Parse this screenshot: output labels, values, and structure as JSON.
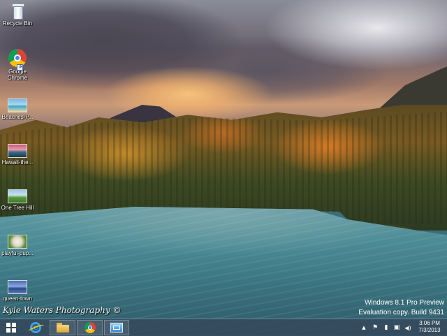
{
  "desktop": {
    "icons": [
      {
        "label": "Recycle Bin"
      },
      {
        "label": "Google Chrome"
      },
      {
        "label": "Beaches-P..."
      },
      {
        "label": "Hawaii-the..."
      },
      {
        "label": "One Tree Hill"
      },
      {
        "label": "playful-pup..."
      },
      {
        "label": "queen-town"
      }
    ],
    "watermark": "Kyle Waters Photography ©",
    "edition_line1": "Windows 8.1 Pro Preview",
    "edition_line2": "Evaluation copy. Build 9431"
  },
  "taskbar": {
    "buttons": [
      {
        "icon": "windows-start-icon"
      },
      {
        "icon": "internet-explorer-icon"
      },
      {
        "icon": "file-explorer-icon"
      },
      {
        "icon": "google-chrome-icon"
      },
      {
        "icon": "remote-desktop-icon"
      }
    ],
    "tray": {
      "up_arrow": "▲",
      "flag": "⚑",
      "battery": "▮",
      "network": "▣",
      "volume": "◀)"
    },
    "clock": {
      "time": "3:06 PM",
      "date": "7/3/2013"
    }
  }
}
